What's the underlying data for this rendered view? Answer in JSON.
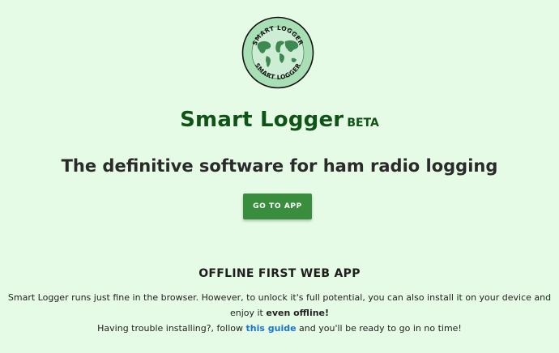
{
  "logo": {
    "text_top": "SMART LOGGER",
    "text_bottom": "SMART LOGGER",
    "icon": "world-map-logo"
  },
  "header": {
    "brand": "Smart Logger",
    "badge": "BETA"
  },
  "hero": {
    "tagline": "The definitive software for ham radio logging",
    "cta_label": "GO TO APP"
  },
  "offline": {
    "title": "OFFLINE FIRST WEB APP",
    "line1_prefix": "Smart Logger runs just fine in the browser. However, to unlock it's full potential, you can also install it on your device and enjoy it",
    "line1_emphasis": "even offline!",
    "line2_prefix": "Having trouble installing?, follow",
    "line2_link": "this guide",
    "line2_suffix": "and you'll be ready to go in no time!"
  },
  "colors": {
    "background": "#e6fbe6",
    "brand": "#0f5316",
    "button": "#388e3c",
    "link": "#1976d2"
  }
}
